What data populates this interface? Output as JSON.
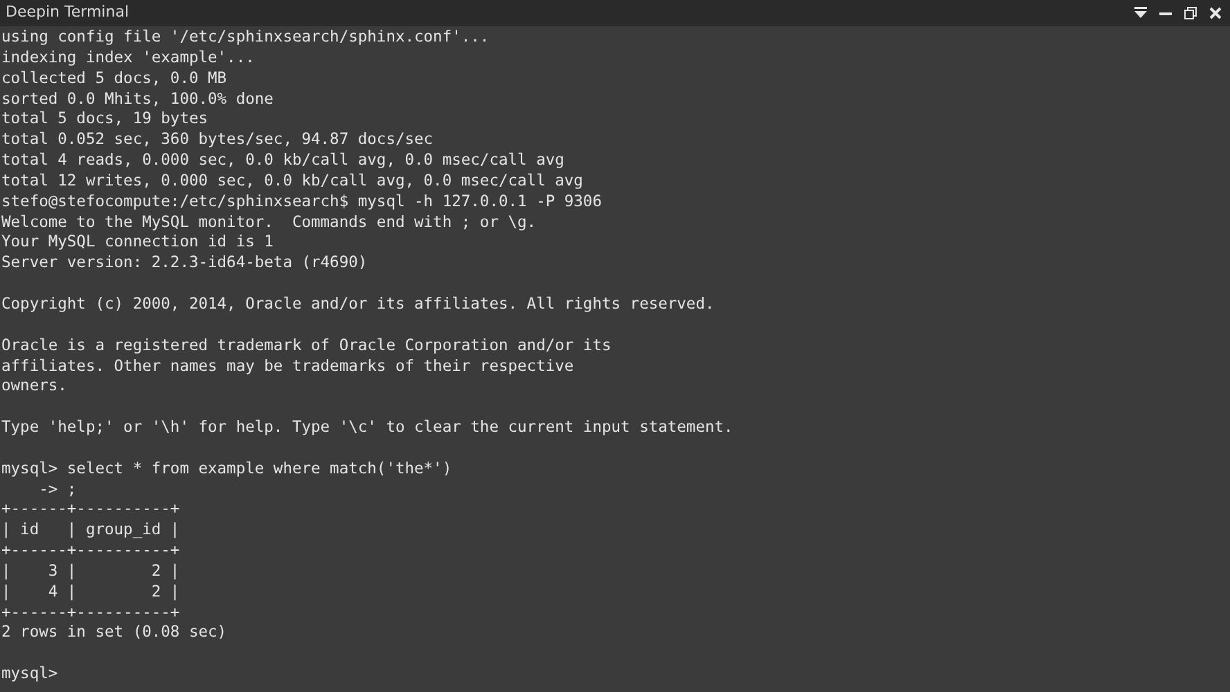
{
  "window": {
    "title": "Deepin Terminal"
  },
  "terminal": {
    "blocks": [
      [
        "using config file '/etc/sphinxsearch/sphinx.conf'...",
        "indexing index 'example'...",
        "collected 5 docs, 0.0 MB",
        "sorted 0.0 Mhits, 100.0% done",
        "total 5 docs, 19 bytes",
        "total 0.052 sec, 360 bytes/sec, 94.87 docs/sec",
        "total 4 reads, 0.000 sec, 0.0 kb/call avg, 0.0 msec/call avg",
        "total 12 writes, 0.000 sec, 0.0 kb/call avg, 0.0 msec/call avg",
        "stefo@stefocompute:/etc/sphinxsearch$ mysql -h 127.0.0.1 -P 9306",
        "Welcome to the MySQL monitor.  Commands end with ; or \\g.",
        "Your MySQL connection id is 1",
        "Server version: 2.2.3-id64-beta (r4690)"
      ],
      [
        "Copyright (c) 2000, 2014, Oracle and/or its affiliates. All rights reserved."
      ],
      [
        "Oracle is a registered trademark of Oracle Corporation and/or its",
        "affiliates. Other names may be trademarks of their respective",
        "owners."
      ],
      [
        "Type 'help;' or '\\h' for help. Type '\\c' to clear the current input statement."
      ],
      [
        "mysql> select * from example where match('the*')",
        "    -> ;",
        "+------+----------+",
        "| id   | group_id |",
        "+------+----------+",
        "|    3 |        2 |",
        "|    4 |        2 |",
        "+------+----------+",
        "2 rows in set (0.08 sec)"
      ],
      [
        "mysql>"
      ]
    ]
  }
}
